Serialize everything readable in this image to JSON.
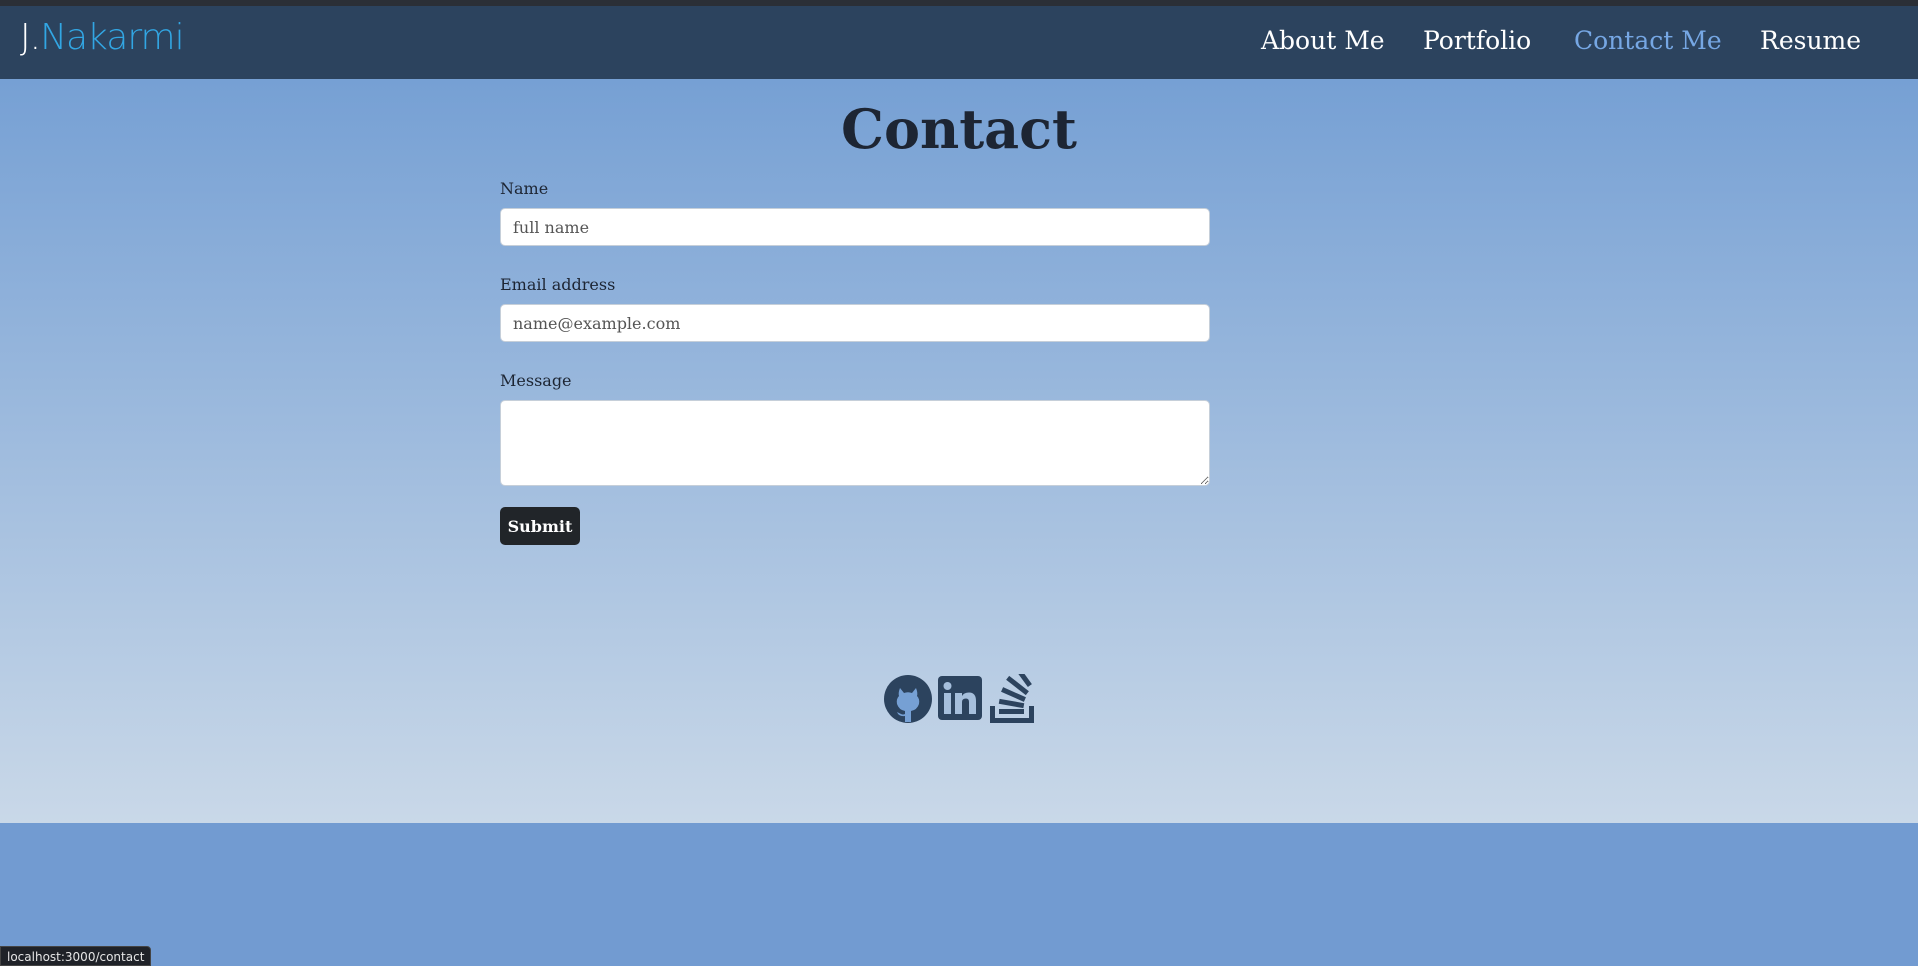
{
  "brand": {
    "prefix": "J.",
    "name": "Nakarmi"
  },
  "nav": {
    "items": [
      {
        "label": "About Me",
        "active": false
      },
      {
        "label": "Portfolio",
        "active": false
      },
      {
        "label": "Contact Me",
        "active": true
      },
      {
        "label": "Resume",
        "active": false
      }
    ]
  },
  "page": {
    "title": "Contact"
  },
  "form": {
    "name_label": "Name",
    "name_placeholder": "full name",
    "email_label": "Email address",
    "email_placeholder": "name@example.com",
    "message_label": "Message",
    "submit_label": "Submit"
  },
  "socials": {
    "icons": [
      "github-icon",
      "linkedin-icon",
      "stackoverflow-icon"
    ],
    "color": "#2c435e"
  },
  "status_bar": {
    "url": "localhost:3000/contact"
  },
  "colors": {
    "navbar": "#2c435e",
    "brand_accent": "#32a6e3",
    "nav_active": "#76a7e4",
    "submit_bg": "#212529"
  }
}
